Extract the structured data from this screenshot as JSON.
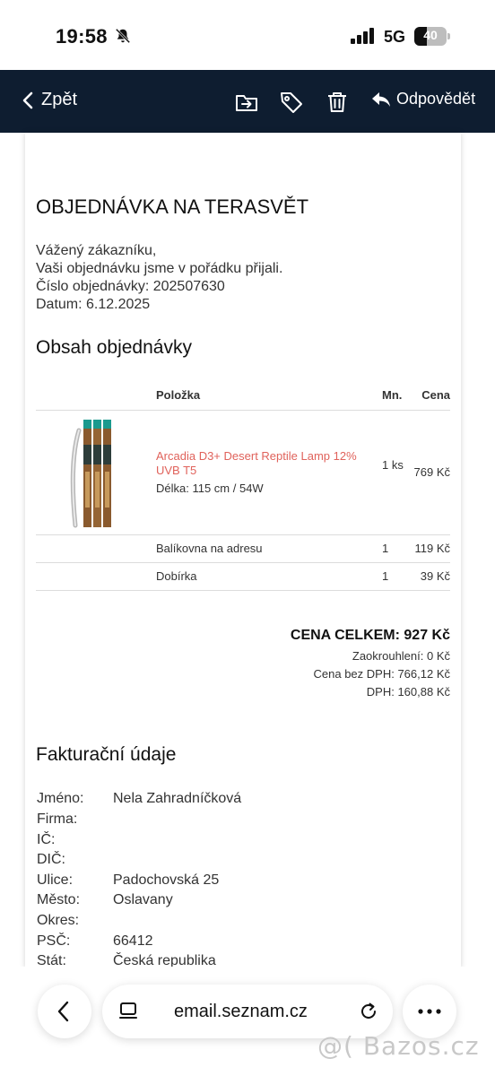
{
  "status": {
    "time": "19:58",
    "network": "5G",
    "battery_level": "40",
    "battery_fraction": 0.4
  },
  "nav": {
    "back_label": "Zpět",
    "reply_label": "Odpovědět"
  },
  "email": {
    "title": "OBJEDNÁVKA NA TERASVĚT",
    "greeting": "Vážený zákazníku,",
    "message": "Vaši objednávku jsme v pořádku přijali.",
    "order_number": "Číslo objednávky: 202507630",
    "date": "Datum: 6.12.2025",
    "contents_heading": "Obsah objednávky",
    "table_headers": {
      "item": "Položka",
      "qty": "Mn.",
      "price": "Cena"
    },
    "product": {
      "name": "Arcadia D3+ Desert Reptile Lamp 12% UVB T5",
      "description": "Délka: 115 cm / 54W",
      "qty": "1 ks",
      "price": "769 Kč"
    },
    "rows": [
      {
        "item": "Balíkovna na adresu",
        "qty": "1",
        "price": "119 Kč"
      },
      {
        "item": "Dobírka",
        "qty": "1",
        "price": "39 Kč"
      }
    ],
    "totals": {
      "total": "CENA CELKEM: 927 Kč",
      "rounding": "Zaokrouhlení: 0 Kč",
      "without_vat": "Cena bez DPH: 766,12 Kč",
      "vat": "DPH: 160,88 Kč"
    },
    "billing_heading": "Fakturační údaje",
    "billing": [
      {
        "label": "Jméno:",
        "value": "Nela Zahradníčková"
      },
      {
        "label": "Firma:",
        "value": ""
      },
      {
        "label": "IČ:",
        "value": ""
      },
      {
        "label": "DIČ:",
        "value": ""
      },
      {
        "label": "Ulice:",
        "value": "Padochovská 25"
      },
      {
        "label": "Město:",
        "value": "Oslavany"
      },
      {
        "label": "Okres:",
        "value": ""
      },
      {
        "label": "PSČ:",
        "value": "66412"
      },
      {
        "label": "Stát:",
        "value": "Česká republika"
      }
    ]
  },
  "browser": {
    "url": "email.seznam.cz"
  },
  "watermark": "@( Bazos.cz",
  "colors": {
    "nav_bg": "#0e1d30",
    "link": "#e0625b"
  },
  "icons": [
    "bell-slash-icon",
    "signal-icon",
    "battery-icon",
    "chevron-left-icon",
    "move-to-folder-icon",
    "tag-icon",
    "trash-icon",
    "reply-icon",
    "tabs-icon",
    "reload-icon",
    "more-icon"
  ]
}
